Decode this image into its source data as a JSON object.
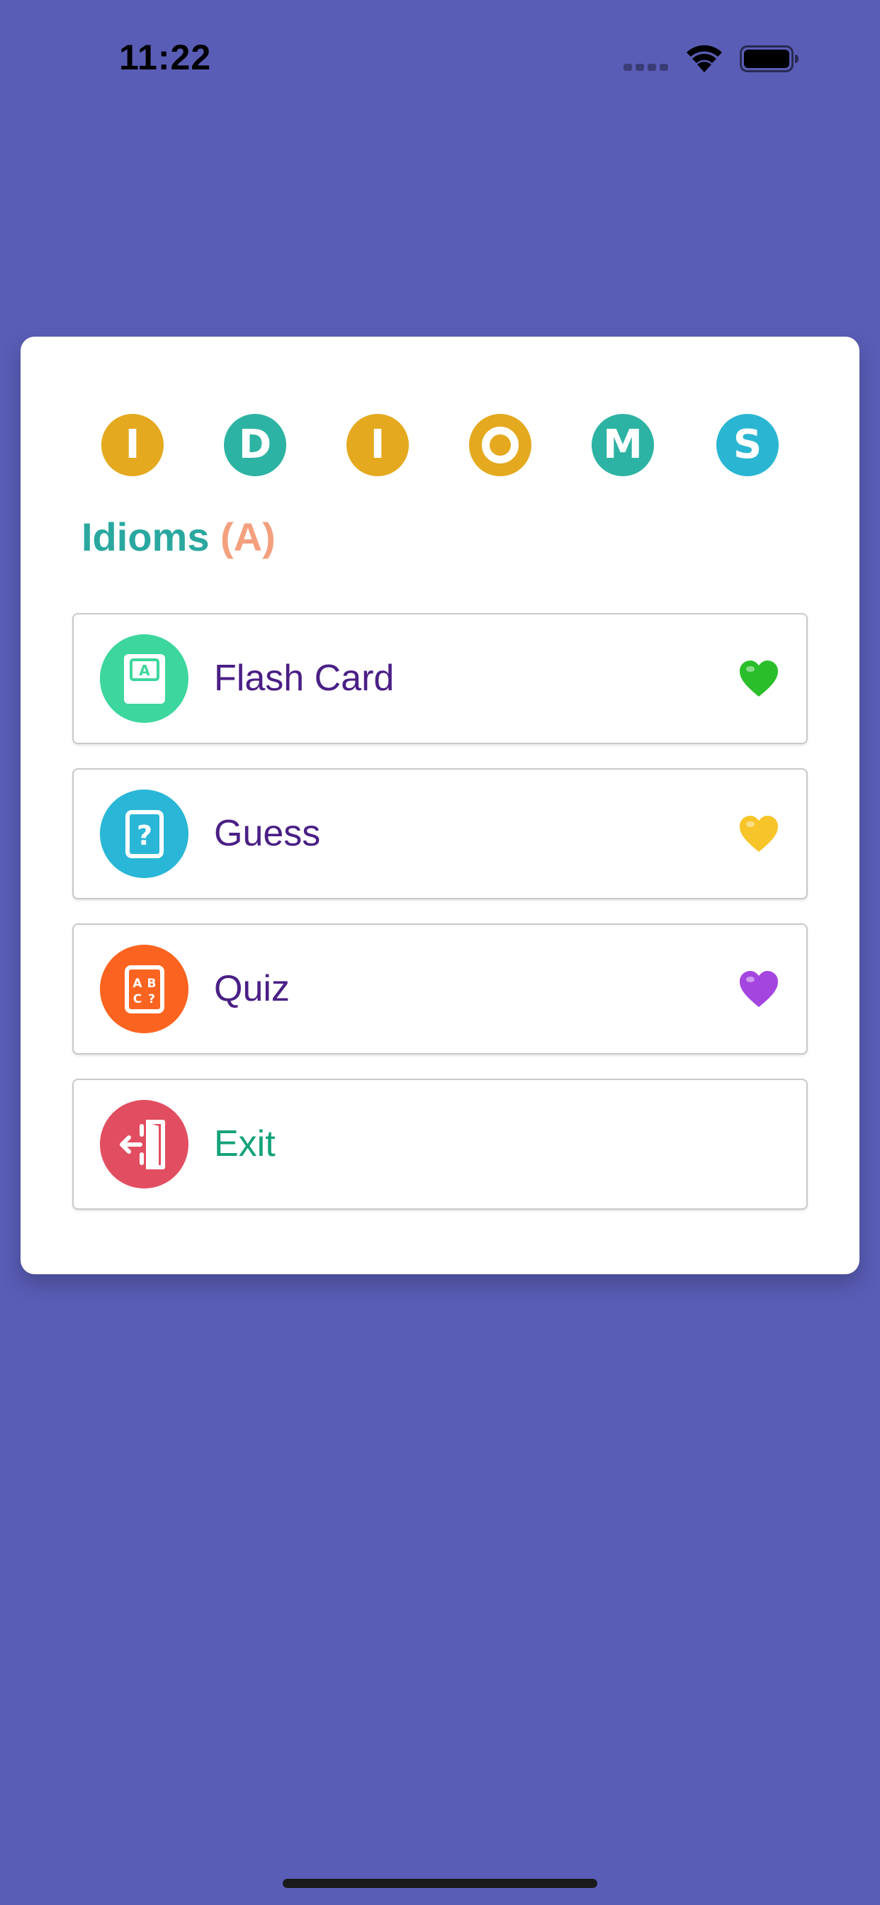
{
  "status_bar": {
    "time": "11:22"
  },
  "header": {
    "letters": [
      {
        "char": "I",
        "color": "#E4A91E"
      },
      {
        "char": "D",
        "color": "#2DB3A3"
      },
      {
        "char": "I",
        "color": "#E4A91E"
      },
      {
        "char": "O",
        "color": "#E4A91E"
      },
      {
        "char": "M",
        "color": "#2DB3A3"
      },
      {
        "char": "S",
        "color": "#2AB6D2"
      }
    ],
    "title_main": "Idioms",
    "title_sub": "(A)"
  },
  "menu": {
    "items": [
      {
        "label": "Flash Card",
        "icon": "flash-card-icon",
        "icon_color": "#3DD69C",
        "heart": "green-heart-icon",
        "heart_color": "#2BBE2B"
      },
      {
        "label": "Guess",
        "icon": "question-card-icon",
        "icon_color": "#2AB6D6",
        "heart": "yellow-heart-icon",
        "heart_color": "#F7C42A"
      },
      {
        "label": "Quiz",
        "icon": "abc-quiz-icon",
        "icon_color": "#FB6420",
        "heart": "purple-heart-icon",
        "heart_color": "#A445E0"
      },
      {
        "label": "Exit",
        "icon": "exit-door-icon",
        "icon_color": "#E24E61"
      }
    ]
  },
  "colors": {
    "background": "#5A5DB6",
    "card": "#FFFFFF",
    "menu_text": "#4A1F85",
    "exit_text": "#14A27A",
    "title_main": "#2AA8A0",
    "title_sub": "#F4A07E"
  }
}
